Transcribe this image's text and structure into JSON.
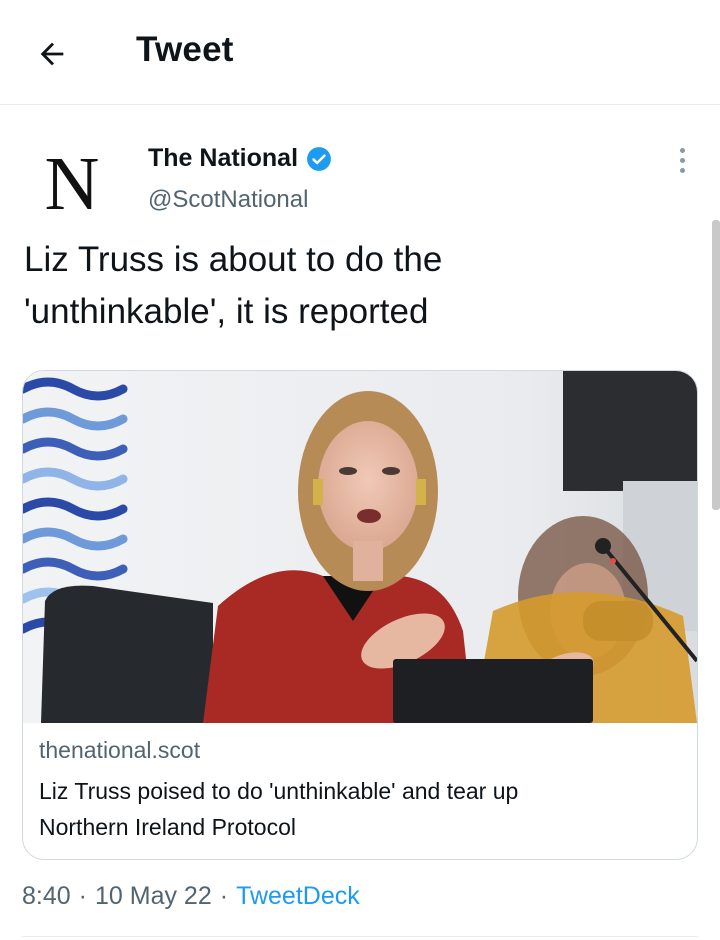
{
  "header": {
    "title": "Tweet"
  },
  "tweet": {
    "author": {
      "name": "The National",
      "handle": "@ScotNational",
      "avatar_letter": "N",
      "verified": true
    },
    "text_line1": "Liz Truss is about to do the",
    "text_line2": "'unthinkable', it is reported",
    "card": {
      "domain": "thenational.scot",
      "title_line1": "Liz Truss poised to do 'unthinkable' and tear up",
      "title_line2": "Northern Ireland Protocol"
    },
    "meta": {
      "time": "8:40",
      "separator1": "·",
      "date": "10 May 22",
      "separator2": "·",
      "source": "TweetDeck"
    }
  },
  "colors": {
    "accent": "#1d9bf0",
    "secondary_text": "#536471",
    "border": "#cfd9de"
  }
}
